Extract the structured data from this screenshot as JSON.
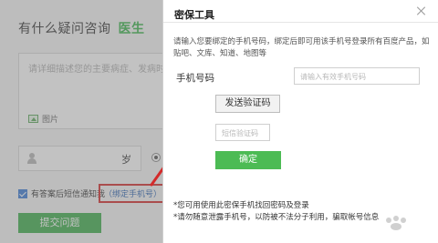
{
  "background_page": {
    "title_prefix": "有什么疑问咨询",
    "title_accent": "医生",
    "textarea_placeholder": "请详细描述您的主要病症、发病时间",
    "image_label": "图片",
    "age_unit": "岁",
    "sms_notify_label": "有答案后短信通知我",
    "bind_phone_link": "（绑定手机号）",
    "submit_label": "提交问题"
  },
  "modal": {
    "title": "密保工具",
    "description": "请输入您要绑定的手机号码，绑定后即可用该手机号登录所有百度产品，如贴吧、文库、知道、地图等",
    "phone_label": "手机号码",
    "phone_placeholder": "请输入有效手机号码",
    "send_code_label": "发送验证码",
    "code_placeholder": "短信验证码",
    "confirm_label": "确定",
    "footnote_line1": "*您可用使用此密保手机找回密码及登录",
    "footnote_line2": "*请勿随意泄露手机号，以防被不法分子利用，骗取帐号信息"
  },
  "colors": {
    "accent_green": "#3dae4b",
    "annotation_red": "#d42a2a",
    "link_blue": "#2d64b3"
  },
  "icons": {
    "close": "close-icon",
    "person": "person-icon",
    "image": "image-icon",
    "checkbox": "checkbox-checked-icon"
  }
}
